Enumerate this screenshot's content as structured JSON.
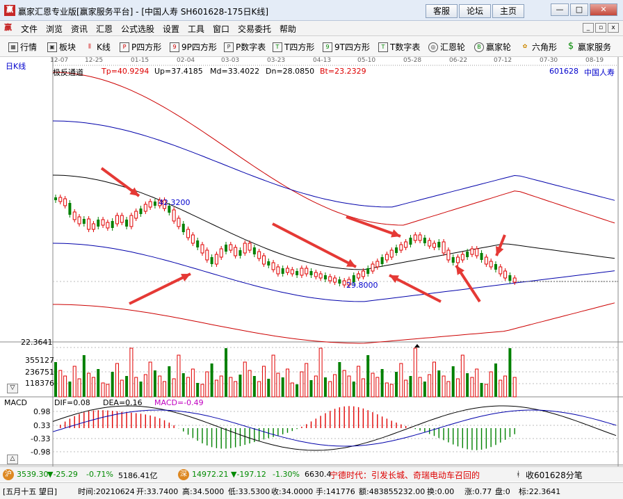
{
  "window": {
    "title": "赢家汇恩专业版[赢家服务平台] - [中国人寿  SH601628-175日K线]",
    "buttons": [
      "客服",
      "论坛",
      "主页"
    ],
    "win_controls": [
      "—",
      "□",
      "✕"
    ]
  },
  "menu": [
    "文件",
    "浏览",
    "资讯",
    "汇恩",
    "公式选股",
    "设置",
    "工具",
    "窗口",
    "交易委托",
    "帮助"
  ],
  "toolbar": [
    {
      "icon": "grid-icon",
      "label": "行情"
    },
    {
      "icon": "blocks-icon",
      "label": "板块"
    },
    {
      "icon": "candle-icon",
      "label": "K线"
    },
    {
      "icon": "p-square-icon",
      "label": "P四方形"
    },
    {
      "icon": "9p-square-icon",
      "label": "9P四方形"
    },
    {
      "icon": "p-table-icon",
      "label": "P数字表"
    },
    {
      "icon": "t-square-icon",
      "label": "T四方形"
    },
    {
      "icon": "9t-square-icon",
      "label": "9T四方形"
    },
    {
      "icon": "t-table-icon",
      "label": "T数字表"
    },
    {
      "icon": "wheel-icon",
      "label": "汇恩轮"
    },
    {
      "icon": "big-wheel-icon",
      "label": "赢家轮"
    },
    {
      "icon": "hexagon-icon",
      "label": "六角形"
    },
    {
      "icon": "dollar-icon",
      "label": "赢家服务"
    }
  ],
  "chart": {
    "period_label": "日K线",
    "indicator_name": "极反通道",
    "tp": "Tp=40.9294",
    "up": "Up=37.4185",
    "md": "Md=33.4022",
    "dn": "Dn=28.0850",
    "bt": "Bt=23.2329",
    "symbol": "601628",
    "name": "中国人寿",
    "dates": [
      "12-07",
      "12-25",
      "01-15",
      "02-04",
      "03-03",
      "03-23",
      "04-13",
      "05-10",
      "05-28",
      "06-22",
      "07-12",
      "07-30",
      "08-19"
    ],
    "high_label": "42.3200",
    "low_label": "29.8000",
    "scale_top": "22.3641",
    "vol_ticks": [
      "355127",
      "236751",
      "118376"
    ],
    "macd_label": "MACD",
    "dif": "DIF=0.08",
    "dea": "DEA=0.16",
    "macd": "MACD=-0.49",
    "macd_ticks": [
      "0.98",
      "0.33",
      "-0.33",
      "-0.98"
    ],
    "colors": {
      "up": "#e00000",
      "down": "#008000",
      "channel_outer": "#cc0000",
      "channel_inner": "#0000aa",
      "mid": "#000000"
    }
  },
  "ticker": {
    "sh_icon": "沪",
    "sh": "3539.30",
    "sh_chg": "▼-25.29",
    "sh_pct": "-0.71%",
    "sh_amt": "5186.41亿",
    "sz_icon": "深",
    "sz": "14972.21",
    "sz_chg": "▼-197.12",
    "sz_pct": "-1.30%",
    "sz_amt": "6630.4",
    "news": "宁德时代：引发长城、奇瑞电动车召回的",
    "right": "收601628分笔"
  },
  "statusbar": {
    "lunar": "[五月十五  望日]",
    "time": "时间:20210624",
    "open": "开:33.7400",
    "high": "高:34.5000",
    "low": "低:33.5300",
    "close": "收:34.0000",
    "hand": "手:141776",
    "amount": "额:483855232.00",
    "turnover": "换:0.00",
    "change": "涨:0.77",
    "panel": "盘:0",
    "mark": "标:22.3641"
  }
}
